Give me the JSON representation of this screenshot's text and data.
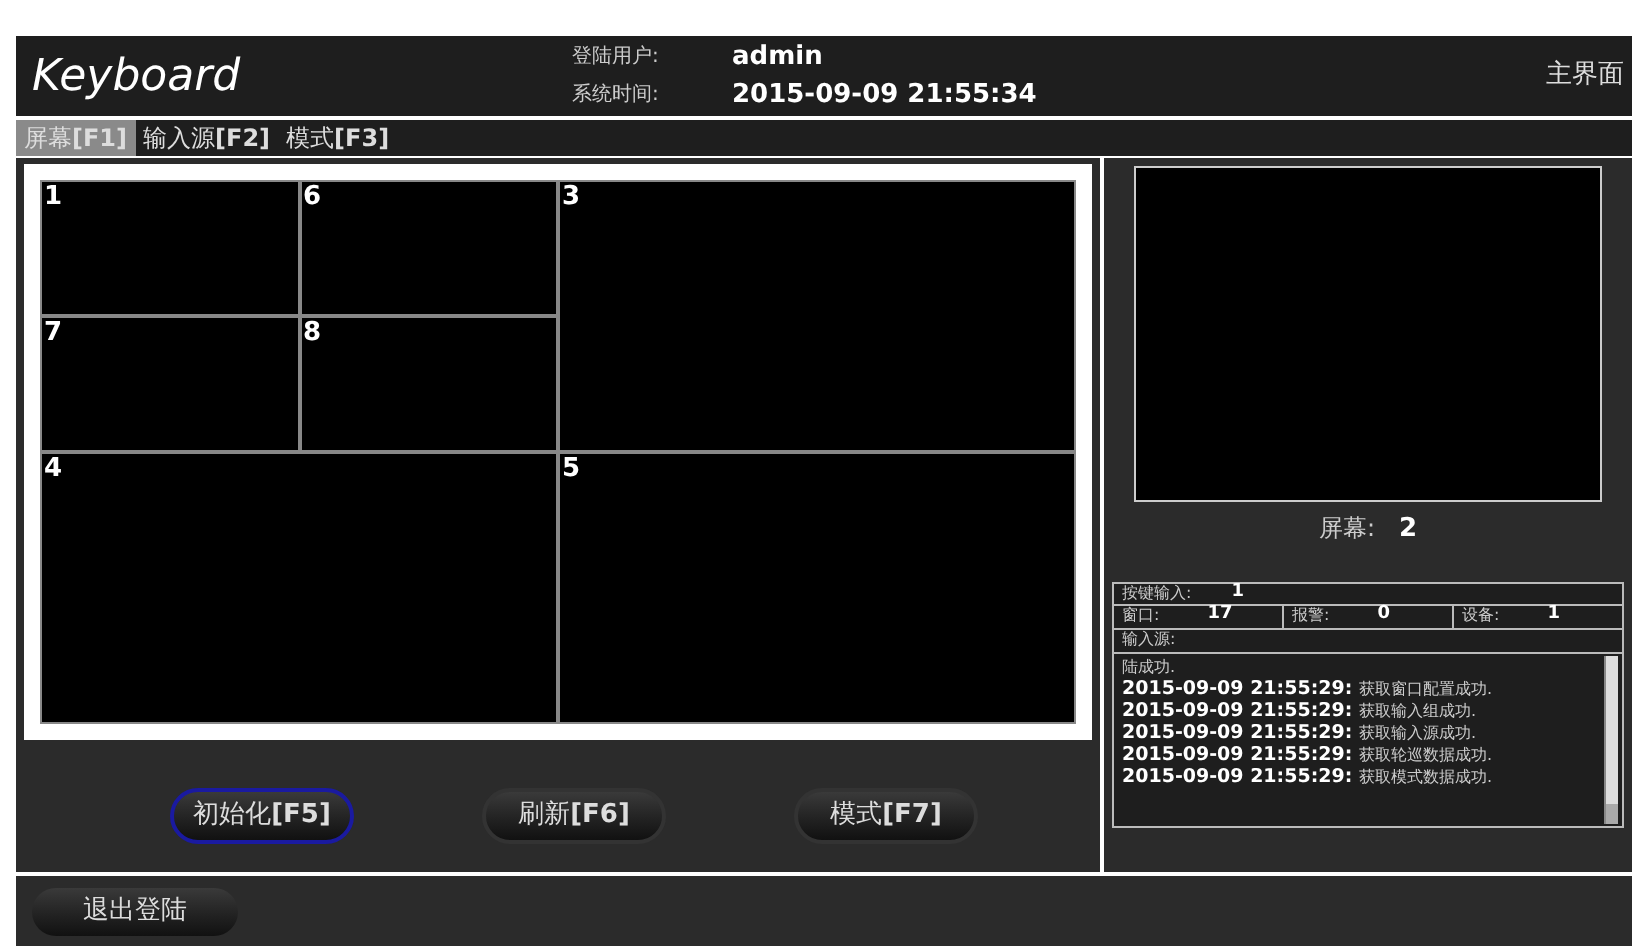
{
  "header": {
    "logo": "Keyboard",
    "user_label": "登陆用户:",
    "user": "admin",
    "time_label": "系统时间:",
    "time": "2015-09-09 21:55:34",
    "home": "主界面"
  },
  "tabs": [
    {
      "label": "屏幕",
      "key": "[F1]",
      "selected": true
    },
    {
      "label": "输入源",
      "key": "[F2]",
      "selected": false
    },
    {
      "label": "模式",
      "key": "[F3]",
      "selected": false
    }
  ],
  "windows": [
    {
      "label": "1",
      "kind": "small"
    },
    {
      "label": "6",
      "kind": "small"
    },
    {
      "label": "3",
      "kind": "large"
    },
    {
      "label": "7",
      "kind": "small"
    },
    {
      "label": "8",
      "kind": "small"
    },
    {
      "label": "4",
      "kind": "large"
    },
    {
      "label": "5",
      "kind": "large"
    }
  ],
  "actions": [
    {
      "label": "初始化",
      "key": "[F5]",
      "selected": true
    },
    {
      "label": "刷新",
      "key": "[F6]",
      "selected": false
    },
    {
      "label": "模式",
      "key": "[F7]",
      "selected": false
    }
  ],
  "preview": {
    "label": "屏幕:",
    "value": "2"
  },
  "info": {
    "input_label": "按键输入:",
    "input": "1",
    "window_label": "窗口:",
    "window": "17",
    "alarm_label": "报警:",
    "alarm": "0",
    "device_label": "设备:",
    "device": "1",
    "source_label": "输入源:"
  },
  "log": [
    {
      "text": "陆成功."
    },
    {
      "time": "2015-09-09 21:55:29:",
      "text": "获取窗口配置成功."
    },
    {
      "time": "2015-09-09 21:55:29:",
      "text": "获取输入组成功."
    },
    {
      "time": "2015-09-09 21:55:29:",
      "text": "获取输入源成功."
    },
    {
      "time": "2015-09-09 21:55:29:",
      "text": "获取轮巡数据成功."
    },
    {
      "time": "2015-09-09 21:55:29:",
      "text": "获取模式数据成功."
    }
  ],
  "logout": "退出登陆"
}
